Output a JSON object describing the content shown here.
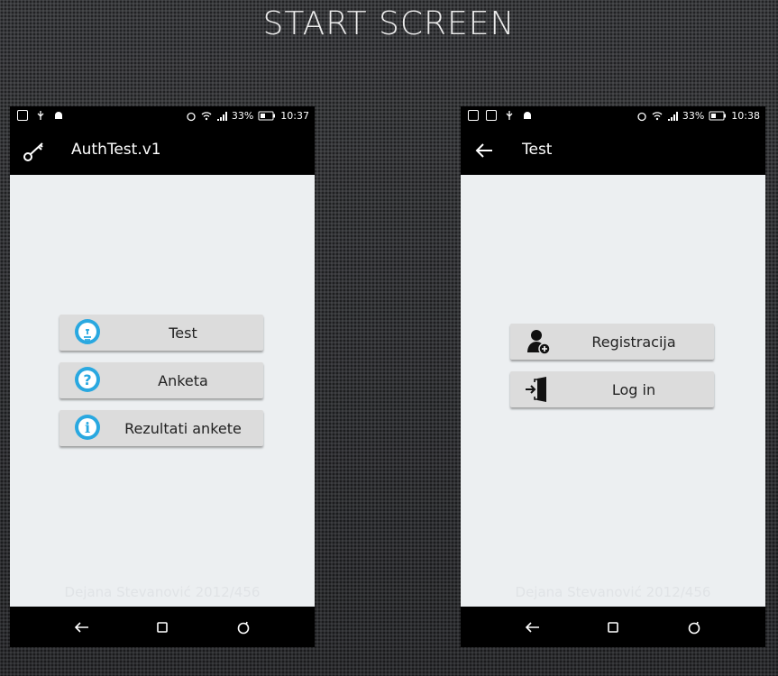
{
  "slide": {
    "title": "START SCREEN"
  },
  "phone1": {
    "status": {
      "battery": "33%",
      "time": "10:37"
    },
    "appbar": {
      "title": "AuthTest.v1",
      "icon": "key-icon"
    },
    "buttons": [
      {
        "label": "Test",
        "icon": "lightbulb-icon"
      },
      {
        "label": "Anketa",
        "icon": "question-icon"
      },
      {
        "label": "Rezultati ankete",
        "icon": "info-icon"
      }
    ],
    "footer": "Dejana Stevanović 2012/456"
  },
  "phone2": {
    "status": {
      "battery": "33%",
      "time": "10:38"
    },
    "appbar": {
      "title": "Test",
      "icon": "back-arrow-icon"
    },
    "buttons": [
      {
        "label": "Registracija",
        "icon": "add-user-icon"
      },
      {
        "label": "Log in",
        "icon": "login-door-icon"
      }
    ],
    "footer": "Dejana Stevanović 2012/456"
  },
  "colors": {
    "accent": "#29a8e0",
    "screen_bg": "#eceff1",
    "button_bg": "#dcdcdc",
    "bar_bg": "#000000"
  }
}
